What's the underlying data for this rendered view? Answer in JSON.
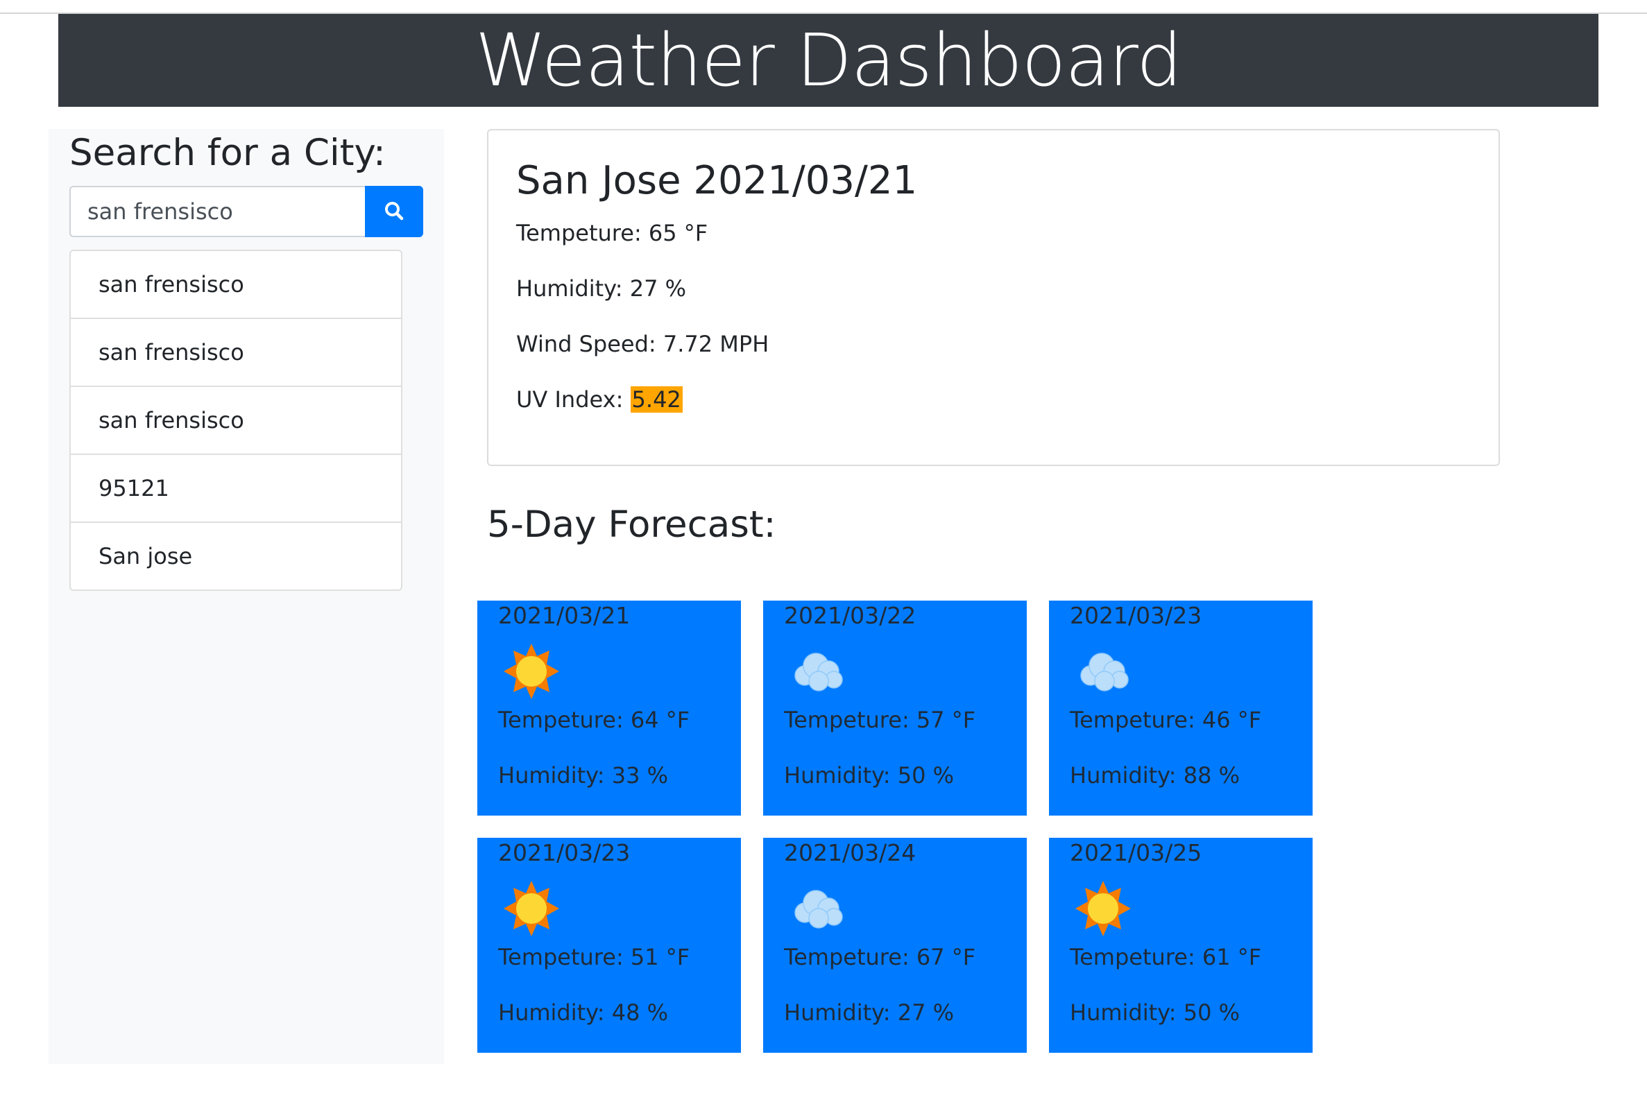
{
  "header": {
    "title": "Weather Dashboard"
  },
  "sidebar": {
    "title": "Search for a City:",
    "search": {
      "value": "san frensisco",
      "button_icon": "search-icon"
    },
    "history": [
      "san frensisco",
      "san frensisco",
      "san frensisco",
      "95121",
      "San jose"
    ]
  },
  "current": {
    "title": "San Jose 2021/03/21",
    "temperature": "Tempeture: 65 °F",
    "humidity": "Humidity: 27 %",
    "wind": "Wind Speed: 7.72 MPH",
    "uv_label": "UV Index: ",
    "uv_value": "5.42",
    "uv_color": "#ffa500"
  },
  "forecast": {
    "title": "5-Day Forecast:",
    "days": [
      {
        "date": "2021/03/21",
        "icon": "sun-icon",
        "temp": "Tempeture: 64 °F",
        "humidity": "Humidity: 33 %"
      },
      {
        "date": "2021/03/22",
        "icon": "cloud-icon",
        "temp": "Tempeture: 57 °F",
        "humidity": "Humidity: 50 %"
      },
      {
        "date": "2021/03/23",
        "icon": "cloud-icon",
        "temp": "Tempeture: 46 °F",
        "humidity": "Humidity: 88 %"
      },
      {
        "date": "2021/03/23",
        "icon": "sun-icon",
        "temp": "Tempeture: 51 °F",
        "humidity": "Humidity: 48 %"
      },
      {
        "date": "2021/03/24",
        "icon": "cloud-icon",
        "temp": "Tempeture: 67 °F",
        "humidity": "Humidity: 27 %"
      },
      {
        "date": "2021/03/25",
        "icon": "sun-icon",
        "temp": "Tempeture: 61 °F",
        "humidity": "Humidity: 50 %"
      }
    ]
  },
  "colors": {
    "header_bg": "#343a40",
    "primary": "#007bff",
    "sidebar_bg": "#f8f9fa"
  }
}
